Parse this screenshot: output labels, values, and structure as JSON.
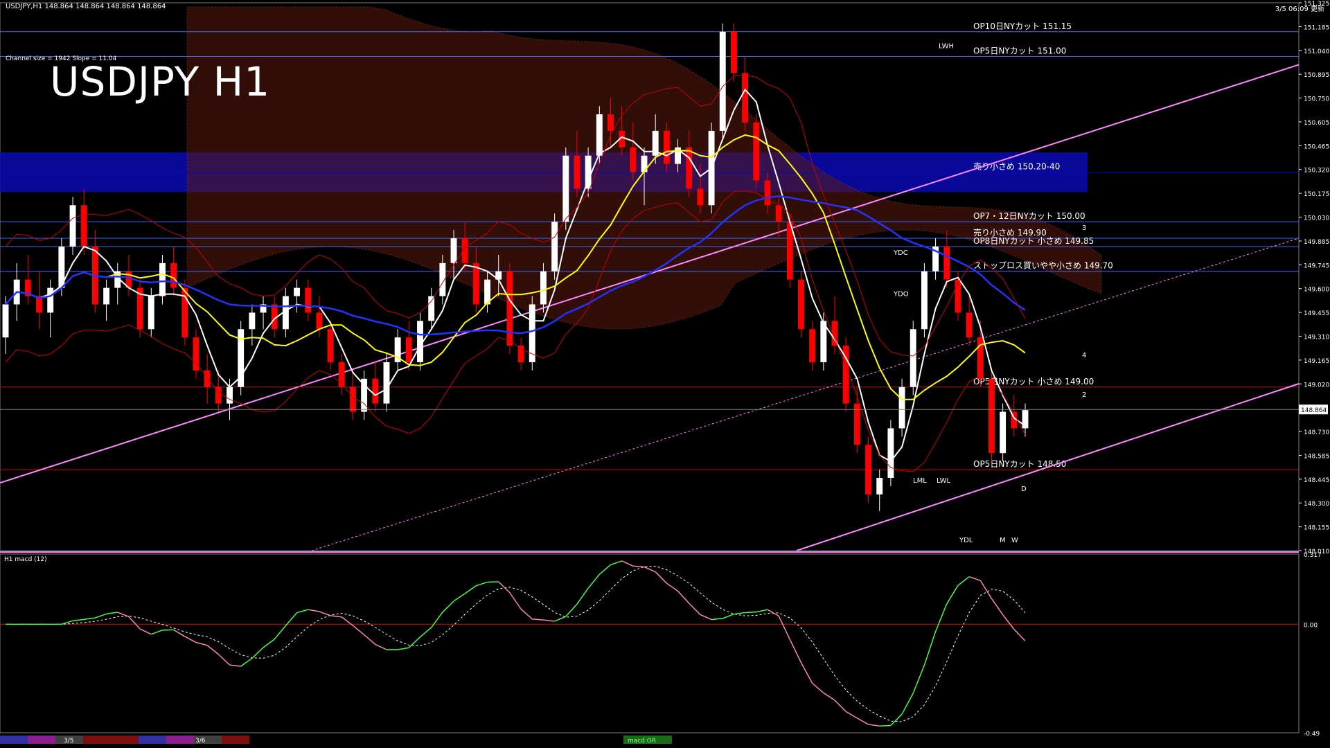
{
  "header": {
    "symbol_line": "USDJPY,H1 148.864 148.864 148.864 148.864",
    "timestamp": "3/5 06:09 更新",
    "title": "USDJPY H1",
    "channel_info": "Channel size = 1942 Slope = 11.04"
  },
  "subpanel": {
    "label": "H1 macd (12)"
  },
  "colors": {
    "background": "#000000",
    "bull_candle": "#ffffff",
    "bear_candle": "#ff0000",
    "ma_white": "#ffffff",
    "ma_yellow": "#ffff00",
    "ma_blue": "#2233ff",
    "envelope_red": "#cc0000",
    "ichimoku_cloud": "#ff6030",
    "channel_pink": "#ff88ff",
    "zone_blue": "#0a0ab4",
    "macd_green": "#44ff44",
    "macd_pink": "#ff88aa"
  },
  "chart_data": {
    "type": "candlestick",
    "symbol": "USDJPY",
    "timeframe": "H1",
    "price_axis": {
      "range": [
        148.01,
        151.325
      ],
      "ticks": [
        "151.325",
        "151.185",
        "151.040",
        "150.895",
        "150.750",
        "150.605",
        "150.465",
        "150.320",
        "150.175",
        "150.030",
        "149.885",
        "149.745",
        "149.600",
        "149.455",
        "149.310",
        "149.165",
        "149.020",
        "148.875",
        "148.730",
        "148.585",
        "148.445",
        "148.300",
        "148.155",
        "148.010"
      ],
      "current_price": "148.864"
    },
    "candles": [
      [
        149.3,
        149.55,
        149.2,
        149.5
      ],
      [
        149.5,
        149.75,
        149.4,
        149.65
      ],
      [
        149.65,
        149.8,
        149.5,
        149.55
      ],
      [
        149.55,
        149.7,
        149.35,
        149.45
      ],
      [
        149.45,
        149.65,
        149.3,
        149.6
      ],
      [
        149.6,
        149.9,
        149.55,
        149.85
      ],
      [
        149.85,
        150.15,
        149.8,
        150.1
      ],
      [
        150.1,
        150.2,
        149.8,
        149.85
      ],
      [
        149.85,
        149.95,
        149.45,
        149.5
      ],
      [
        149.5,
        149.65,
        149.4,
        149.6
      ],
      [
        149.6,
        149.75,
        149.5,
        149.7
      ],
      [
        149.7,
        149.8,
        149.55,
        149.6
      ],
      [
        149.6,
        149.65,
        149.3,
        149.35
      ],
      [
        149.35,
        149.6,
        149.3,
        149.55
      ],
      [
        149.55,
        149.8,
        149.5,
        149.75
      ],
      [
        149.75,
        149.85,
        149.55,
        149.6
      ],
      [
        149.6,
        149.65,
        149.25,
        149.3
      ],
      [
        149.3,
        149.35,
        149.05,
        149.1
      ],
      [
        149.1,
        149.2,
        148.9,
        149.0
      ],
      [
        149.0,
        149.1,
        148.85,
        148.9
      ],
      [
        148.9,
        149.05,
        148.8,
        149.0
      ],
      [
        149.0,
        149.4,
        148.95,
        149.35
      ],
      [
        149.35,
        149.5,
        149.25,
        149.45
      ],
      [
        149.45,
        149.55,
        149.35,
        149.5
      ],
      [
        149.5,
        149.55,
        149.3,
        149.35
      ],
      [
        149.35,
        149.6,
        149.3,
        149.55
      ],
      [
        149.55,
        149.65,
        149.45,
        149.6
      ],
      [
        149.6,
        149.65,
        149.4,
        149.45
      ],
      [
        149.45,
        149.55,
        149.3,
        149.35
      ],
      [
        149.35,
        149.4,
        149.1,
        149.15
      ],
      [
        149.15,
        149.2,
        148.95,
        149.0
      ],
      [
        149.0,
        149.1,
        148.8,
        148.85
      ],
      [
        148.85,
        149.1,
        148.8,
        149.05
      ],
      [
        149.05,
        149.15,
        148.85,
        148.9
      ],
      [
        148.9,
        149.2,
        148.85,
        149.15
      ],
      [
        149.15,
        149.35,
        149.1,
        149.3
      ],
      [
        149.3,
        149.4,
        149.1,
        149.15
      ],
      [
        149.15,
        149.45,
        149.1,
        149.4
      ],
      [
        149.4,
        149.6,
        149.35,
        149.55
      ],
      [
        149.55,
        149.8,
        149.5,
        149.75
      ],
      [
        149.75,
        149.95,
        149.65,
        149.9
      ],
      [
        149.9,
        150.0,
        149.7,
        149.75
      ],
      [
        149.75,
        149.85,
        149.45,
        149.5
      ],
      [
        149.5,
        149.7,
        149.45,
        149.65
      ],
      [
        149.65,
        149.8,
        149.55,
        149.7
      ],
      [
        149.7,
        149.75,
        149.2,
        149.25
      ],
      [
        149.25,
        149.3,
        149.1,
        149.15
      ],
      [
        149.15,
        149.55,
        149.1,
        149.5
      ],
      [
        149.5,
        149.75,
        149.45,
        149.7
      ],
      [
        149.7,
        150.05,
        149.65,
        150.0
      ],
      [
        150.0,
        150.45,
        149.95,
        150.4
      ],
      [
        150.4,
        150.55,
        150.15,
        150.2
      ],
      [
        150.2,
        150.45,
        150.15,
        150.4
      ],
      [
        150.4,
        150.7,
        150.35,
        150.65
      ],
      [
        150.65,
        150.75,
        150.45,
        150.55
      ],
      [
        150.55,
        150.7,
        150.4,
        150.45
      ],
      [
        150.45,
        150.6,
        150.25,
        150.3
      ],
      [
        150.3,
        150.45,
        150.1,
        150.4
      ],
      [
        150.4,
        150.65,
        150.35,
        150.55
      ],
      [
        150.55,
        150.6,
        150.3,
        150.35
      ],
      [
        150.35,
        150.5,
        150.3,
        150.45
      ],
      [
        150.45,
        150.55,
        150.15,
        150.2
      ],
      [
        150.2,
        150.35,
        150.05,
        150.1
      ],
      [
        150.1,
        150.6,
        150.05,
        150.55
      ],
      [
        150.55,
        151.2,
        150.5,
        151.15
      ],
      [
        151.15,
        151.2,
        150.85,
        150.9
      ],
      [
        150.9,
        151.0,
        150.55,
        150.6
      ],
      [
        150.6,
        150.65,
        150.2,
        150.25
      ],
      [
        150.25,
        150.3,
        150.05,
        150.1
      ],
      [
        150.1,
        150.15,
        149.9,
        150.0
      ],
      [
        150.0,
        150.05,
        149.6,
        149.65
      ],
      [
        149.65,
        149.7,
        149.3,
        149.35
      ],
      [
        149.35,
        149.4,
        149.1,
        149.15
      ],
      [
        149.15,
        149.45,
        149.1,
        149.4
      ],
      [
        149.4,
        149.55,
        149.2,
        149.25
      ],
      [
        149.25,
        149.3,
        148.85,
        148.9
      ],
      [
        148.9,
        149.0,
        148.6,
        148.65
      ],
      [
        148.65,
        148.7,
        148.3,
        148.35
      ],
      [
        148.35,
        148.5,
        148.25,
        148.45
      ],
      [
        148.45,
        148.8,
        148.4,
        148.75
      ],
      [
        148.75,
        149.05,
        148.7,
        149.0
      ],
      [
        149.0,
        149.4,
        148.95,
        149.35
      ],
      [
        149.35,
        149.75,
        149.3,
        149.7
      ],
      [
        149.7,
        149.9,
        149.65,
        149.85
      ],
      [
        149.85,
        149.95,
        149.6,
        149.65
      ],
      [
        149.65,
        149.7,
        149.4,
        149.45
      ],
      [
        149.45,
        149.55,
        149.25,
        149.3
      ],
      [
        149.3,
        149.4,
        149.0,
        149.05
      ],
      [
        149.05,
        149.1,
        148.55,
        148.6
      ],
      [
        148.6,
        148.9,
        148.55,
        148.85
      ],
      [
        148.85,
        148.95,
        148.7,
        148.75
      ],
      [
        148.75,
        148.9,
        148.7,
        148.86
      ]
    ],
    "levels": [
      {
        "label": "OP10日NYカット 151.15",
        "price": 151.15,
        "color": "#3a6aff"
      },
      {
        "label": "OP5日NYカット 151.00",
        "price": 151.0,
        "color": "#3a6aff"
      },
      {
        "label": "売り小さめ 150.20-40",
        "price": 150.3,
        "color": "#0a0ab4"
      },
      {
        "label": "OP7・12日NYカット 150.00",
        "price": 150.0,
        "color": "#3a6aff"
      },
      {
        "label": "売り小さめ 149.90",
        "price": 149.9,
        "color": "#3a6aff"
      },
      {
        "label": "OP8日NYカット 小さめ 149.85",
        "price": 149.85,
        "color": "#3a6aff"
      },
      {
        "label": "ストップロス買いやや小さめ 149.70",
        "price": 149.7,
        "color": "#3a6aff"
      },
      {
        "label": "OP5日NYカット 小さめ 149.00",
        "price": 149.0,
        "color": "#cc0000"
      },
      {
        "label": "OP5日NYカット 148.50",
        "price": 148.5,
        "color": "#cc0000"
      }
    ],
    "markers": [
      "YDC",
      "YDO",
      "LML",
      "LWL",
      "YDL",
      "LWH",
      "M",
      "W",
      "D",
      "2",
      "3",
      "4"
    ],
    "macd": {
      "label": "H1 macd (12)",
      "range": [
        -0.49,
        0.317
      ],
      "ticks": [
        "0.317",
        "0.00",
        "-0.49"
      ]
    },
    "time_labels": [
      "3/5",
      "3/6"
    ],
    "bottom_label": "macd OR"
  }
}
